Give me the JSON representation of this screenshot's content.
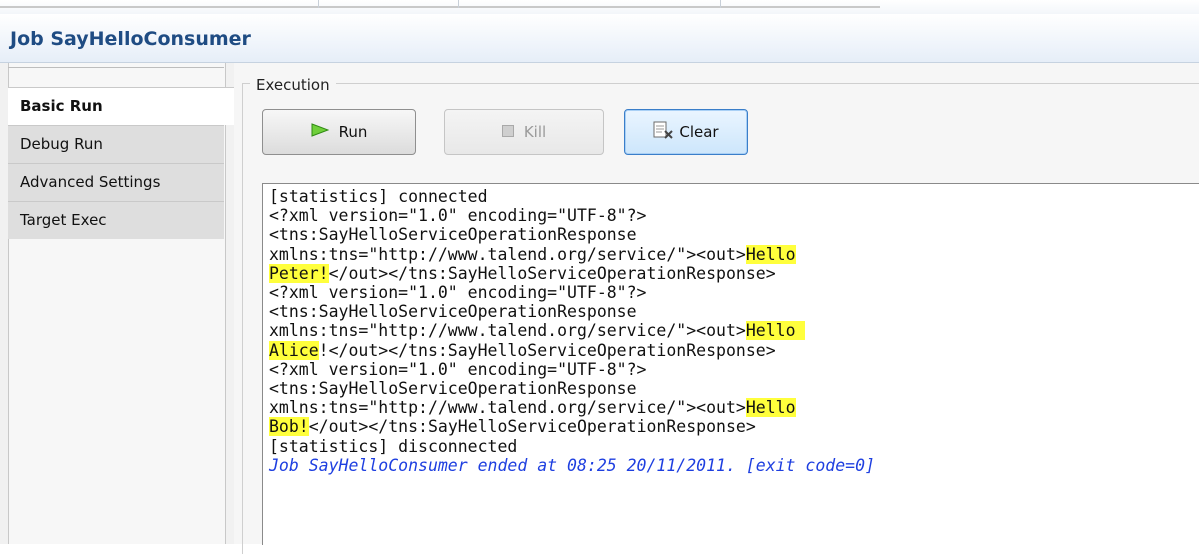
{
  "view": {
    "title": "Job SayHelloConsumer"
  },
  "tabs": [
    {
      "label": "Basic Run",
      "active": true
    },
    {
      "label": "Debug Run",
      "active": false
    },
    {
      "label": "Advanced Settings",
      "active": false
    },
    {
      "label": "Target Exec",
      "active": false
    }
  ],
  "execution": {
    "group_label": "Execution",
    "run_label": "Run",
    "kill_label": "Kill",
    "clear_label": "Clear",
    "run_icon": "play-icon",
    "kill_icon": "stop-icon",
    "clear_icon": "clear-console-icon"
  },
  "console": {
    "lines": {
      "l1": "[statistics] connected",
      "l2": "<?xml version=\"1.0\" encoding=\"UTF-8\"?>",
      "l3": "<tns:SayHelloServiceOperationResponse",
      "l4_pre": "xmlns:tns=\"http://www.talend.org/service/\"><out>",
      "l4_hl": "Hello",
      "l5_hl": "Peter!",
      "l5_post": "</out></tns:SayHelloServiceOperationResponse>",
      "l6": "<?xml version=\"1.0\" encoding=\"UTF-8\"?>",
      "l7": "<tns:SayHelloServiceOperationResponse",
      "l8_pre": "xmlns:tns=\"http://www.talend.org/service/\"><out>",
      "l8_hl": "Hello ",
      "l9_hl": "Alice",
      "l9_post": "!</out></tns:SayHelloServiceOperationResponse>",
      "l10": "<?xml version=\"1.0\" encoding=\"UTF-8\"?>",
      "l11": "<tns:SayHelloServiceOperationResponse",
      "l12_pre": "xmlns:tns=\"http://www.talend.org/service/\"><out>",
      "l12_hl": "Hello",
      "l13_hl": "Bob!",
      "l13_post": "</out></tns:SayHelloServiceOperationResponse>",
      "l14": "[statistics] disconnected",
      "l15": "Job SayHelloConsumer ended at 08:25 20/11/2011. [exit code=0]"
    }
  },
  "colors": {
    "title": "#1f4c83",
    "highlight": "#ffff3c",
    "status": "#1e3fe0"
  }
}
